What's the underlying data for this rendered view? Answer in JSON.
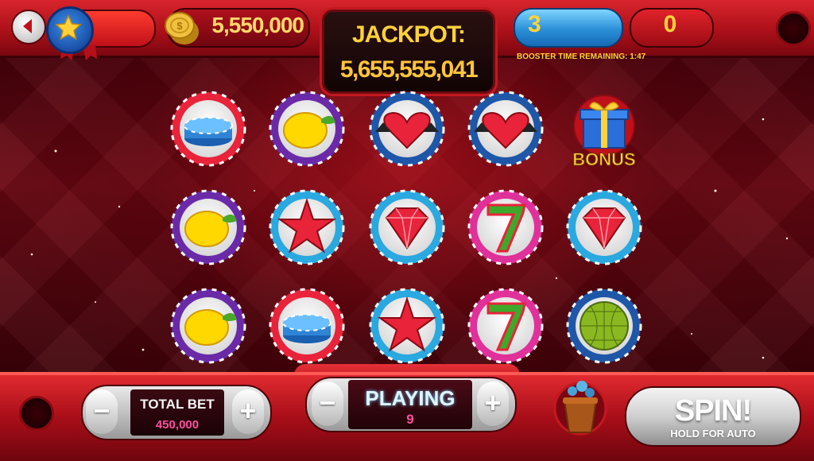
{
  "header": {
    "coins": "5,550,000",
    "jackpot_label": "JACKPOT:",
    "jackpot_value": "5,655,555,041",
    "booster_count": "3",
    "booster_time": "BOOSTER TIME REMAINING: 1:47",
    "counter": "0",
    "icons": [
      "back-arrow-icon",
      "star-level-icon",
      "gold-coin-icon"
    ]
  },
  "reels": {
    "rows": [
      [
        "blue-chips",
        "lemon",
        "heart-spade",
        "heart-spade",
        "bonus-gift"
      ],
      [
        "lemon",
        "red-star",
        "diamond",
        "seven",
        "diamond"
      ],
      [
        "lemon",
        "blue-chips",
        "red-star",
        "seven",
        "disco-ball"
      ]
    ],
    "bonus_text": "BONUS"
  },
  "controls": {
    "total_bet_label": "TOTAL BET",
    "total_bet_value": "450,000",
    "minus": "−",
    "plus": "+",
    "playing_label": "PLAYING",
    "playing_value": "9",
    "spin_label": "SPIN!",
    "spin_sub": "HOLD FOR AUTO"
  },
  "colors": {
    "accent_gold": "#ffd23a",
    "header_red": "#d8242c",
    "bet_pink": "#ff4fa0"
  }
}
